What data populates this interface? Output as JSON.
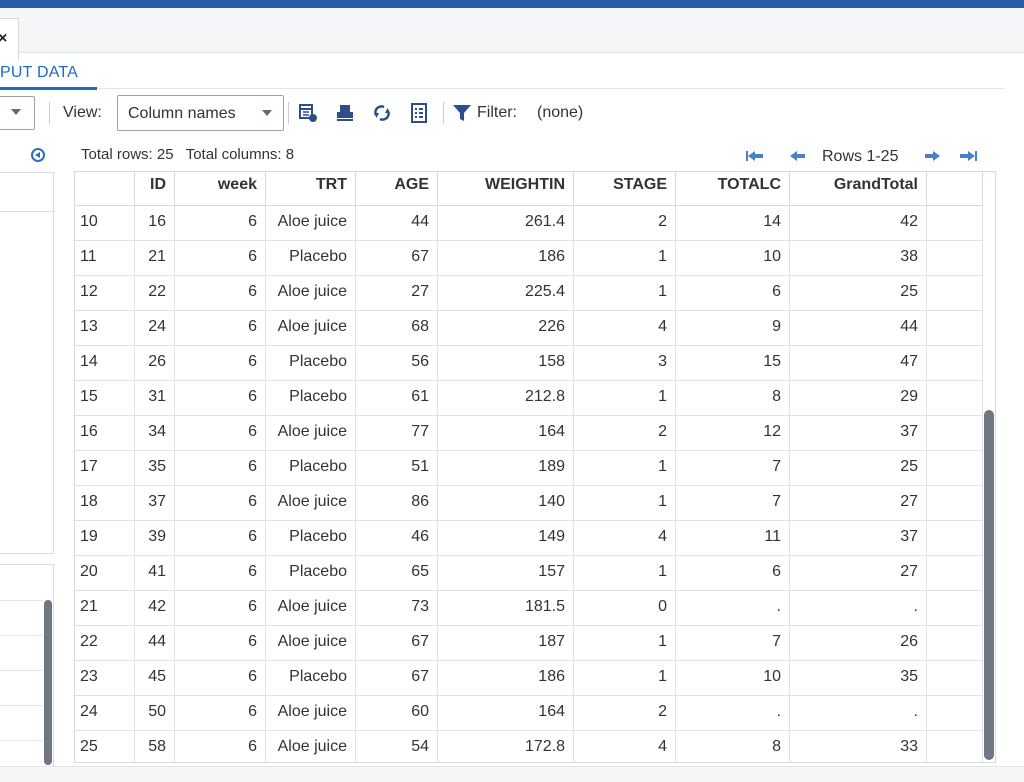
{
  "window": {
    "close_glyph": "×"
  },
  "tabs": {
    "active": "PUT DATA"
  },
  "toolbar": {
    "view_label": "View:",
    "view_value": "Column names",
    "filter_label": "Filter:",
    "filter_value": "(none)",
    "icons": [
      "table-properties-icon",
      "print-icon",
      "refresh-icon",
      "list-view-icon",
      "filter-icon"
    ]
  },
  "summary": {
    "total_rows": "Total rows: 25",
    "total_columns": "Total columns: 8",
    "rows_range": "Rows 1-25"
  },
  "table": {
    "columns": [
      "",
      "ID",
      "week",
      "TRT",
      "AGE",
      "WEIGHTIN",
      "STAGE",
      "TOTALC",
      "GrandTotal"
    ],
    "rows": [
      [
        "10",
        "16",
        "6",
        "Aloe juice",
        "44",
        "261.4",
        "2",
        "14",
        "42"
      ],
      [
        "11",
        "21",
        "6",
        "Placebo",
        "67",
        "186",
        "1",
        "10",
        "38"
      ],
      [
        "12",
        "22",
        "6",
        "Aloe juice",
        "27",
        "225.4",
        "1",
        "6",
        "25"
      ],
      [
        "13",
        "24",
        "6",
        "Aloe juice",
        "68",
        "226",
        "4",
        "9",
        "44"
      ],
      [
        "14",
        "26",
        "6",
        "Placebo",
        "56",
        "158",
        "3",
        "15",
        "47"
      ],
      [
        "15",
        "31",
        "6",
        "Placebo",
        "61",
        "212.8",
        "1",
        "8",
        "29"
      ],
      [
        "16",
        "34",
        "6",
        "Aloe juice",
        "77",
        "164",
        "2",
        "12",
        "37"
      ],
      [
        "17",
        "35",
        "6",
        "Placebo",
        "51",
        "189",
        "1",
        "7",
        "25"
      ],
      [
        "18",
        "37",
        "6",
        "Aloe juice",
        "86",
        "140",
        "1",
        "7",
        "27"
      ],
      [
        "19",
        "39",
        "6",
        "Placebo",
        "46",
        "149",
        "4",
        "11",
        "37"
      ],
      [
        "20",
        "41",
        "6",
        "Placebo",
        "65",
        "157",
        "1",
        "6",
        "27"
      ],
      [
        "21",
        "42",
        "6",
        "Aloe juice",
        "73",
        "181.5",
        "0",
        ".",
        "."
      ],
      [
        "22",
        "44",
        "6",
        "Aloe juice",
        "67",
        "187",
        "1",
        "7",
        "26"
      ],
      [
        "23",
        "45",
        "6",
        "Placebo",
        "67",
        "186",
        "1",
        "10",
        "35"
      ],
      [
        "24",
        "50",
        "6",
        "Aloe juice",
        "60",
        "164",
        "2",
        ".",
        "."
      ],
      [
        "25",
        "58",
        "6",
        "Aloe juice",
        "54",
        "172.8",
        "4",
        "8",
        "33"
      ]
    ]
  },
  "colors": {
    "accent": "#1f6bc1",
    "topbar": "#2a5da8"
  }
}
